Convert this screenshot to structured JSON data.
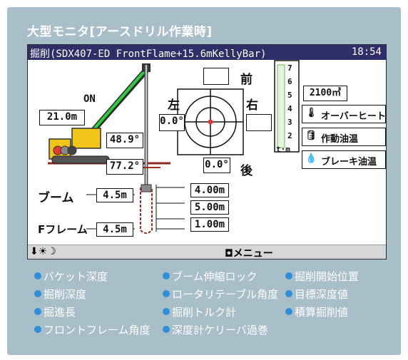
{
  "panel_title": "大型モニタ[アースドリル作業時]",
  "screen": {
    "title": "掘削(SDX407-ED FrontFlame+15.6mKellyBar)",
    "clock": "18:54",
    "crane": {
      "on_label": "ON",
      "left_value": "21.0m",
      "boom_angle": "48.9°",
      "front_angle": "77.2°"
    },
    "compass": {
      "front_label": "前",
      "rear_label": "後",
      "left_label": "左",
      "right_label": "右",
      "left_value": "0.0°",
      "right_value": "",
      "top_value": "",
      "bottom_value": "0.0°"
    },
    "gauge_scale": [
      "7",
      "6",
      "5",
      "4",
      "3",
      "2"
    ],
    "gauge_unit": "t·m",
    "info": {
      "volume": "2100㎥",
      "overheat": "オーバーヒート",
      "hydraulic_oil": "作動油温",
      "brake_oil": "ブレーキ油温"
    },
    "depth": {
      "boom_label": "ブーム",
      "boom_value": "4.5m",
      "frame_label": "Fフレーム",
      "frame_value": "4.5m",
      "values": [
        "4.00m",
        "5.00m",
        "1.00m"
      ]
    },
    "bottom": {
      "left": "⬇☀☽",
      "menu": "◘メニュー"
    }
  },
  "legend": [
    "バケット深度",
    "ブーム伸縮ロック",
    "掘削開始位置",
    "掘削深度",
    "ロータリテーブル角度",
    "目標深度値",
    "掘進長",
    "掘削トルク計",
    "積算掘削値",
    "フロントフレーム角度",
    "深度計ケリーバ過巻"
  ],
  "colors": {
    "panel": "#a8bec9",
    "titlebar": "#2f2e68",
    "legend_dot": "#2f8fd6",
    "boom": "#2ecc40",
    "machine": "#f0c419",
    "indicator_red": "#e53935",
    "gauge_green": "#6abf45"
  }
}
